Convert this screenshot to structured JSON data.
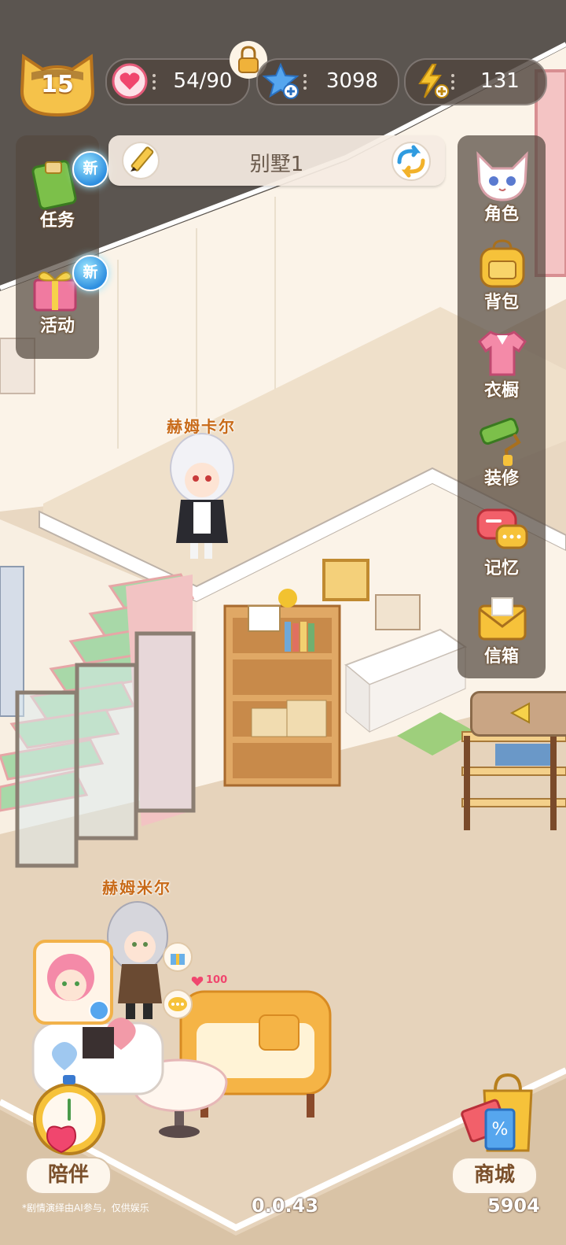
{
  "hud": {
    "level": "15",
    "hearts": "54/90",
    "stars": "3098",
    "energy": "131"
  },
  "room": {
    "name": "别墅1"
  },
  "left_menu": [
    {
      "label": "任务",
      "badge": "新",
      "icon": "task-book-icon"
    },
    {
      "label": "活动",
      "badge": "新",
      "icon": "gift-box-icon"
    }
  ],
  "right_menu": [
    {
      "label": "角色",
      "icon": "fox-character-icon"
    },
    {
      "label": "背包",
      "icon": "backpack-icon"
    },
    {
      "label": "衣橱",
      "icon": "shirt-icon"
    },
    {
      "label": "装修",
      "icon": "paint-roller-icon"
    },
    {
      "label": "记忆",
      "icon": "chat-bubbles-icon"
    },
    {
      "label": "信箱",
      "icon": "envelope-icon"
    }
  ],
  "characters": {
    "upper_name": "赫姆卡尔",
    "lower_name": "赫姆米尔",
    "affection": "100"
  },
  "bottom": {
    "companion_label": "陪伴",
    "shop_label": "商城",
    "disclaimer": "*剧情演绎由AI参与，仅供娱乐",
    "version": "0.0.43",
    "counter": "5904"
  },
  "colors": {
    "wall": "#fbf1e4",
    "floor": "#e9d8c2",
    "panel": "#554a40",
    "accent_orange": "#f2a93b",
    "stair_green": "#a8d8a8"
  }
}
